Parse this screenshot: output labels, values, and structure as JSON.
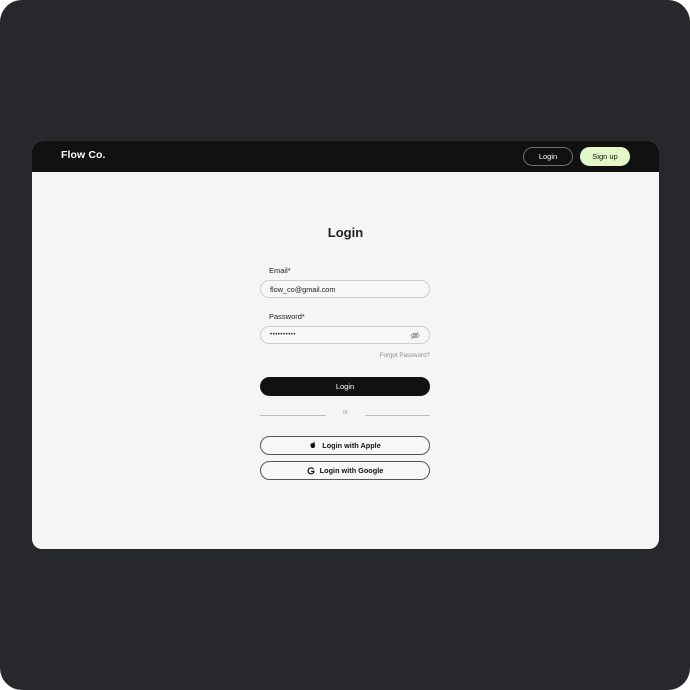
{
  "header": {
    "brand": "Flow Co.",
    "login_label": "Login",
    "signup_label": "Sign up"
  },
  "form": {
    "title": "Login",
    "email_label": "Email*",
    "email_value": "flow_co@gmail.com",
    "password_label": "Password*",
    "password_value": "••••••••••",
    "forgot_label": "Forgot Password?",
    "submit_label": "Login",
    "divider_text": "or",
    "apple_label": "Login with Apple",
    "google_label": "Login with Google"
  },
  "icons": {
    "password_toggle": "eye-off-icon",
    "apple": "apple-icon",
    "google": "google-icon"
  },
  "colors": {
    "background": "#27282b",
    "topbar": "#111111",
    "content": "#f5f5f5",
    "signup_accent": "#e3f7c8",
    "primary_button": "#111111"
  }
}
